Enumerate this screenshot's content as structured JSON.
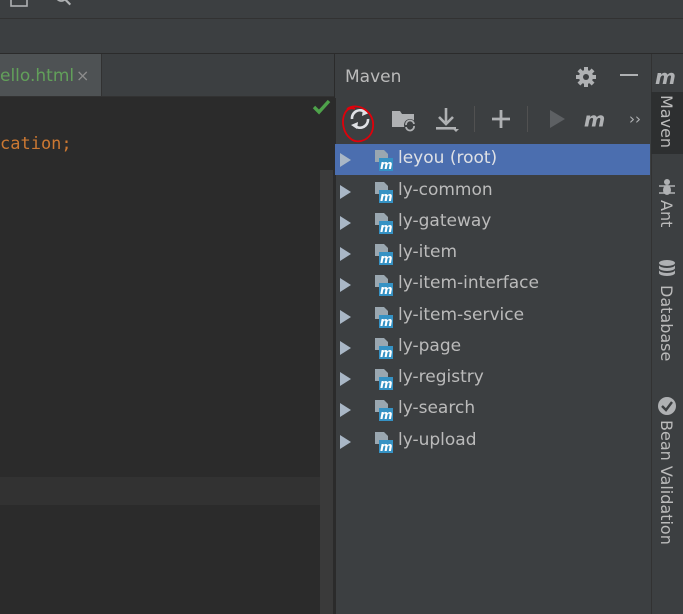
{
  "editor": {
    "tab_label": "ello.html",
    "tab_close": "×",
    "code_keyword": "cation",
    "code_punct": ";"
  },
  "maven": {
    "title": "Maven",
    "toolbar": {
      "overflow": "››"
    },
    "projects": [
      {
        "label": "leyou (root)",
        "selected": true
      },
      {
        "label": "ly-common"
      },
      {
        "label": "ly-gateway"
      },
      {
        "label": "ly-item"
      },
      {
        "label": "ly-item-interface"
      },
      {
        "label": "ly-item-service"
      },
      {
        "label": "ly-page"
      },
      {
        "label": "ly-registry"
      },
      {
        "label": "ly-search"
      },
      {
        "label": "ly-upload"
      }
    ]
  },
  "side_tabs": {
    "maven": "Maven",
    "ant": "Ant",
    "database": "Database",
    "bean_validation": "Bean Validation"
  },
  "colors": {
    "panel_bg": "#3c3f41",
    "editor_bg": "#2b2b2b",
    "selection": "#4b6eaf",
    "annotation": "#e0000a"
  }
}
